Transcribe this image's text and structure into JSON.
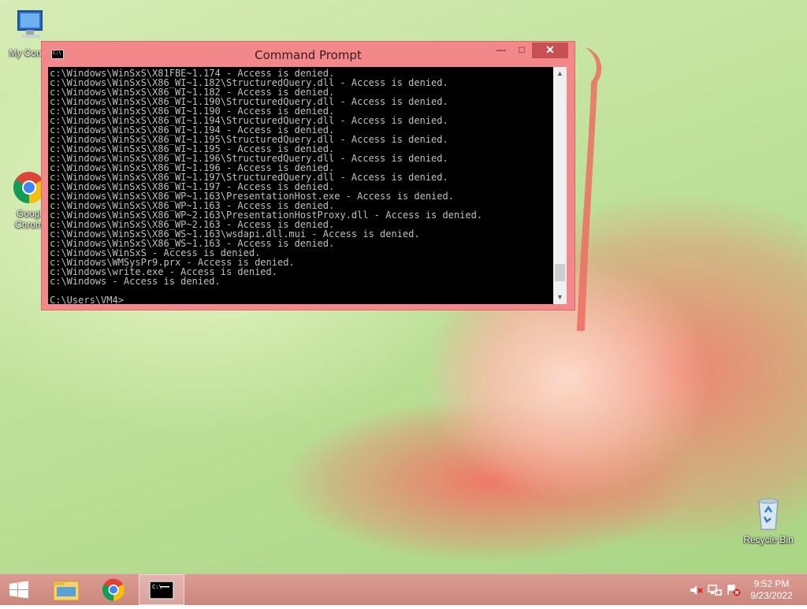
{
  "desktop": {
    "icons": [
      {
        "label": "My Comp"
      },
      {
        "label": "Googl\nChrom"
      },
      {
        "label": "Recycle Bin"
      }
    ]
  },
  "window": {
    "title": "Command Prompt",
    "console_lines": [
      "c:\\Windows\\WinSxS\\X81FBE~1.174 - Access is denied.",
      "c:\\Windows\\WinSxS\\X86_WI~1.182\\StructuredQuery.dll - Access is denied.",
      "c:\\Windows\\WinSxS\\X86_WI~1.182 - Access is denied.",
      "c:\\Windows\\WinSxS\\X86_WI~1.190\\StructuredQuery.dll - Access is denied.",
      "c:\\Windows\\WinSxS\\X86_WI~1.190 - Access is denied.",
      "c:\\Windows\\WinSxS\\X86_WI~1.194\\StructuredQuery.dll - Access is denied.",
      "c:\\Windows\\WinSxS\\X86_WI~1.194 - Access is denied.",
      "c:\\Windows\\WinSxS\\X86_WI~1.195\\StructuredQuery.dll - Access is denied.",
      "c:\\Windows\\WinSxS\\X86_WI~1.195 - Access is denied.",
      "c:\\Windows\\WinSxS\\X86_WI~1.196\\StructuredQuery.dll - Access is denied.",
      "c:\\Windows\\WinSxS\\X86_WI~1.196 - Access is denied.",
      "c:\\Windows\\WinSxS\\X86_WI~1.197\\StructuredQuery.dll - Access is denied.",
      "c:\\Windows\\WinSxS\\X86_WI~1.197 - Access is denied.",
      "c:\\Windows\\WinSxS\\X86_WP~1.163\\PresentationHost.exe - Access is denied.",
      "c:\\Windows\\WinSxS\\X86_WP~1.163 - Access is denied.",
      "c:\\Windows\\WinSxS\\X86_WP~2.163\\PresentationHostProxy.dll - Access is denied.",
      "c:\\Windows\\WinSxS\\X86_WP~2.163 - Access is denied.",
      "c:\\Windows\\WinSxS\\X86_WS~1.163\\wsdapi.dll.mui - Access is denied.",
      "c:\\Windows\\WinSxS\\X86_WS~1.163 - Access is denied.",
      "c:\\Windows\\WinSxS - Access is denied.",
      "c:\\Windows\\WMSysPr9.prx - Access is denied.",
      "c:\\Windows\\write.exe - Access is denied.",
      "c:\\Windows - Access is denied.",
      "",
      "C:\\Users\\VM4>"
    ],
    "scroll_position": 0.95
  },
  "taskbar": {
    "items": [
      "start-icon",
      "file-explorer-icon",
      "chrome-icon",
      "command-prompt-icon"
    ],
    "tray": {
      "time": "9:52 PM",
      "date": "9/23/2022"
    }
  },
  "colors": {
    "window_frame": "#f2888a",
    "close_button": "#c75050",
    "console_bg": "#000000",
    "console_text": "#c0c0c0"
  }
}
